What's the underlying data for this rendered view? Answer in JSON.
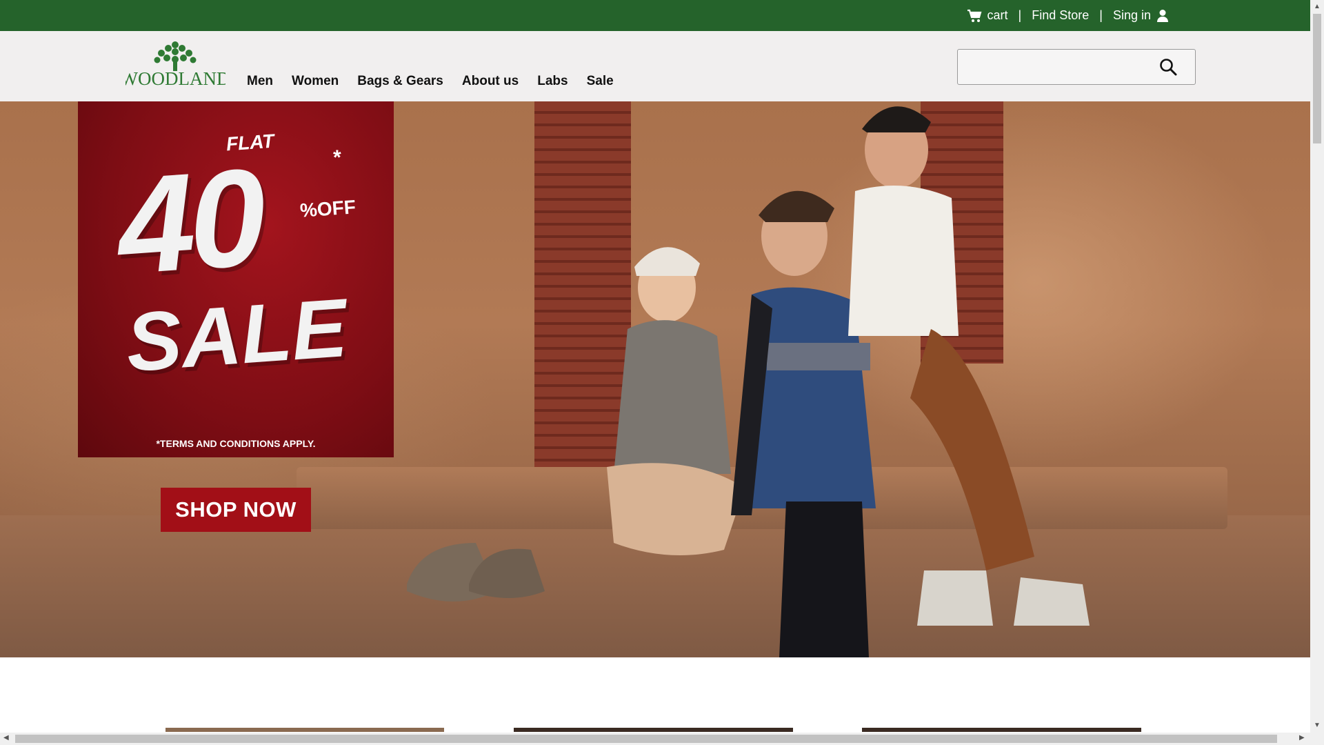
{
  "topbar": {
    "cart_label": "cart",
    "find_store_label": "Find Store",
    "signin_label": "Sing in",
    "separator": "|"
  },
  "header": {
    "logo_text": "WOODLAND",
    "nav": [
      "Men",
      "Women",
      "Bags & Gears",
      "About us",
      "Labs",
      "Sale"
    ],
    "search_placeholder": ""
  },
  "hero": {
    "promo_flat": "FLAT",
    "promo_number": "40",
    "promo_percent": "%OFF",
    "promo_star": "*",
    "promo_sale": "SALE",
    "promo_terms": "*TERMS AND CONDITIONS APPLY.",
    "cta_label": "SHOP NOW"
  },
  "colors": {
    "topbar_bg": "#25632b",
    "header_bg": "#f1efef",
    "promo_red": "#a20f17"
  }
}
